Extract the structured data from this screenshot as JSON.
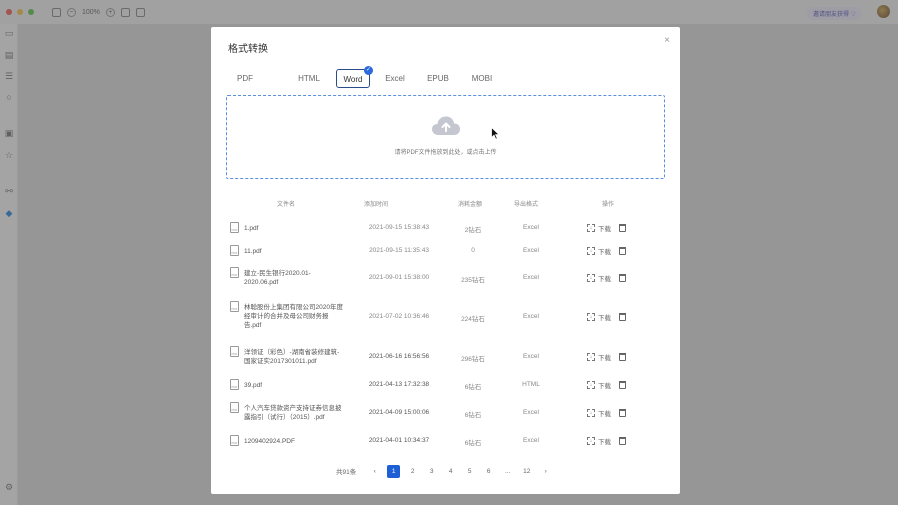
{
  "window": {
    "zoom": "100%",
    "invite_label": "邀请朋友获得",
    "colors": {
      "close": "#ee5f57",
      "minimize": "#f4bd4f",
      "maximize": "#5fc453",
      "accent": "#1f5fd6"
    }
  },
  "sidebar": {
    "icons": [
      "folder-icon",
      "page-icon",
      "list-icon",
      "search-icon",
      "lock-icon",
      "star-icon",
      "share-icon",
      "plugin-icon",
      "settings-icon"
    ]
  },
  "modal": {
    "title": "格式转换",
    "close": "×",
    "tabs": [
      {
        "label": "PDF"
      },
      {
        "label": "HTML"
      },
      {
        "label": "Word"
      },
      {
        "label": "Excel"
      },
      {
        "label": "EPUB"
      },
      {
        "label": "MOBI"
      }
    ],
    "active_tab": "Word",
    "dropzone_text": "请将PDF文件拖放到此处，或点击上传",
    "columns": [
      "文件名",
      "添加时间",
      "消耗金额",
      "导出格式",
      "操作"
    ],
    "download_label": "下载",
    "rows": [
      {
        "name": "1.pdf",
        "time": "2021-09-15 15:38:43",
        "cost": "2钻石",
        "format": "Excel"
      },
      {
        "name": "11.pdf",
        "time": "2021-09-15 11:35:43",
        "cost": "0",
        "format": "Excel"
      },
      {
        "name": "建立-民生银行2020.01-2020.06.pdf",
        "time": "2021-09-01 15:38:00",
        "cost": "235钻石",
        "format": "Excel"
      },
      {
        "name": "林聪股份上集团有限公司2020年度经审计的合并及母公司财务报告.pdf",
        "time": "2021-07-02 10:36:46",
        "cost": "224钻石",
        "format": "Excel"
      },
      {
        "name": "洋领证（彩色）-湖南省装修建筑-国家证实2017301011.pdf",
        "time": "2021-06-16 16:56:56",
        "cost": "296钻石",
        "format": "Excel"
      },
      {
        "name": "39.pdf",
        "time": "2021-04-13 17:32:38",
        "cost": "6钻石",
        "format": "HTML"
      },
      {
        "name": "个人汽车贷款资产支持证券信息披露指引（试行）（2015）.pdf",
        "time": "2021-04-09 15:00:06",
        "cost": "6钻石",
        "format": "Excel"
      },
      {
        "name": "1209402924.PDF",
        "time": "2021-04-01 10:34:37",
        "cost": "6钻石",
        "format": "Excel"
      }
    ],
    "pagination": {
      "total": "共91条",
      "prev": "‹",
      "next": "›",
      "pages": [
        "1",
        "2",
        "3",
        "4",
        "5",
        "6",
        "...",
        "12"
      ],
      "current": "1"
    }
  }
}
